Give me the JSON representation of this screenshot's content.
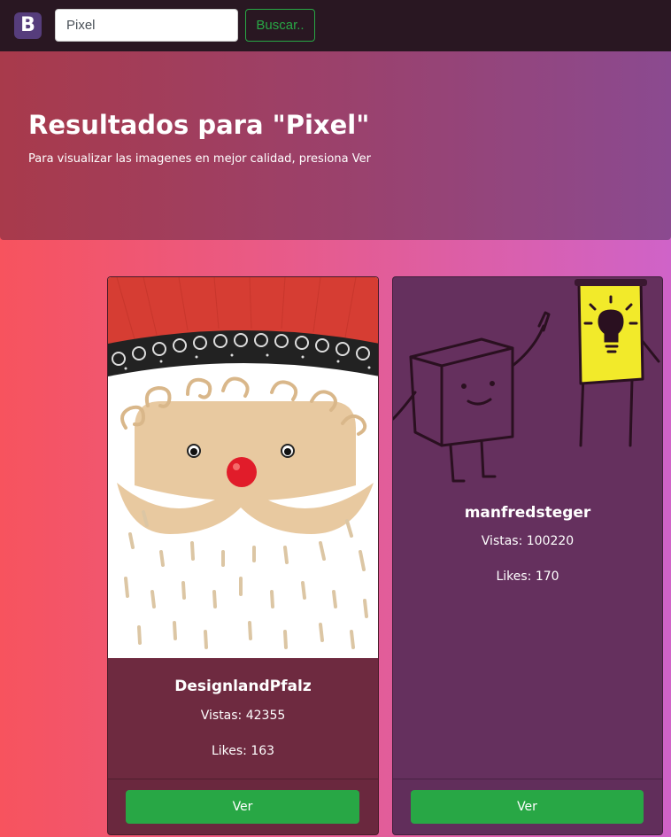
{
  "navbar": {
    "brand_letter": "B",
    "search_value": "Pixel",
    "search_button_label": "Buscar.."
  },
  "hero": {
    "title": "Resultados para \"Pixel\"",
    "subtitle": "Para visualizar las imagenes en mejor calidad, presiona Ver"
  },
  "results": [
    {
      "user": "DesignlandPfalz",
      "views": "Vistas: 42355",
      "likes": "Likes: 163",
      "button_label": "Ver",
      "image": "santa-claus-illustration"
    },
    {
      "user": "manfredsteger",
      "views": "Vistas: 100220",
      "likes": "Likes: 170",
      "button_label": "Ver",
      "image": "cartoon-box-character-with-idea-flipchart"
    }
  ],
  "colors": {
    "navbar_bg": "#291722",
    "brand_bg": "#563d7c",
    "button_green": "#28a745",
    "card1_bg": "#6e2a40",
    "card2_bg": "#65305e"
  }
}
